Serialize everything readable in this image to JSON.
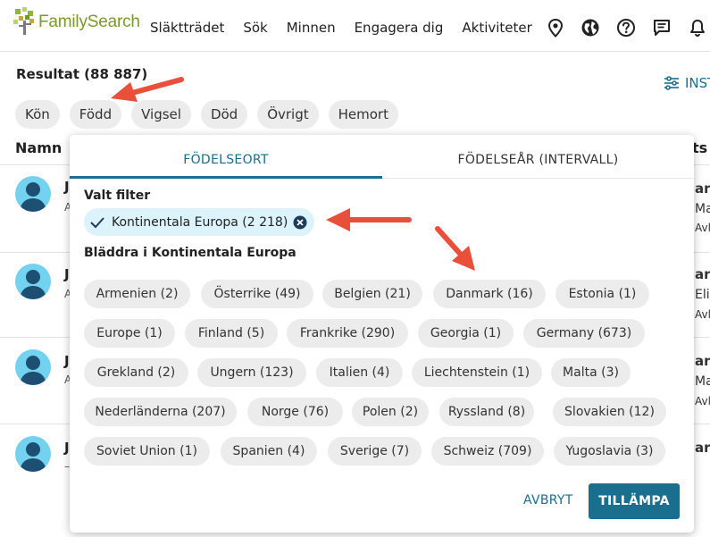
{
  "header": {
    "logo_text": "FamilySearch",
    "nav": [
      "Släktträdet",
      "Sök",
      "Minnen",
      "Engagera dig",
      "Aktiviteter"
    ],
    "icons": [
      "location-pin-icon",
      "globe-icon",
      "help-icon",
      "messages-icon",
      "bell-icon"
    ]
  },
  "results": {
    "title": "Resultat (88 887)",
    "settings_label": "INST"
  },
  "filter_tabs": [
    "Kön",
    "Född",
    "Vigsel",
    "Död",
    "Övrigt",
    "Hemort"
  ],
  "columns": {
    "name": "Namn",
    "right": "ts"
  },
  "rows": [
    {
      "frag": "J",
      "sub": "A",
      "right": [
        "ar/",
        "Mar",
        "Avlid"
      ]
    },
    {
      "frag": "J",
      "sub": "A",
      "right": [
        "ar/",
        "Eliz",
        "Avlid"
      ]
    },
    {
      "frag": "J",
      "sub": "A",
      "right": [
        "ar/",
        "Mar",
        "Avlid"
      ]
    },
    {
      "frag": "J",
      "sub": "–",
      "right": [
        "ar/",
        "",
        ""
      ]
    }
  ],
  "popup": {
    "tabs": [
      "FÖDELSEORT",
      "FÖDELSEÅR (INTERVALL)"
    ],
    "selected_heading": "Valt filter",
    "selected_chip": "Kontinentala Europa (2 218)",
    "browse_heading": "Bläddra i Kontinentala Europa",
    "chips": [
      [
        "Armenien (2)",
        "Österrike (49)",
        "Belgien (21)",
        "Danmark (16)",
        "Estonia (1)"
      ],
      [
        "Europe (1)",
        "Finland (5)",
        "Frankrike (290)",
        "Georgia (1)",
        "Germany (673)"
      ],
      [
        "Grekland (2)",
        "Ungern (123)",
        "Italien (4)",
        "Liechtenstein (1)",
        "Malta (3)"
      ],
      [
        "Nederländerna (207)",
        "Norge (76)",
        "Polen (2)",
        "Ryssland (8)",
        "Slovakien (12)"
      ],
      [
        "Soviet Union (1)",
        "Spanien (4)",
        "Sverige (7)",
        "Schweiz (709)",
        "Yugoslavia (3)"
      ]
    ],
    "cancel_label": "AVBRYT",
    "apply_label": "TILLÄMPA"
  },
  "colors": {
    "accent": "#1a6e8e",
    "chip_bg": "#ececec",
    "selected_chip_bg": "#dcf3fb",
    "avatar_bg": "#73d2ef",
    "annotation_arrow": "#e8503a",
    "logo_green": "#7a9a2c"
  }
}
